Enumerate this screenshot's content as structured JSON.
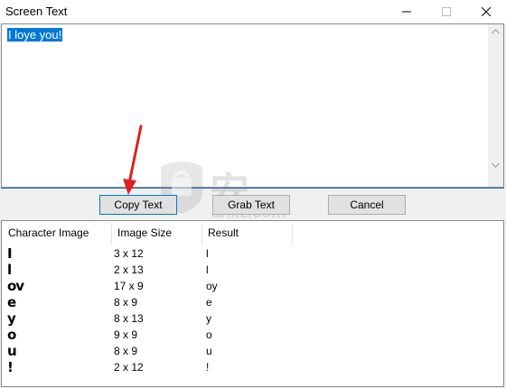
{
  "window": {
    "title": "Screen Text",
    "controls": [
      "minimize-icon",
      "maximize-icon",
      "close-icon"
    ]
  },
  "textarea": {
    "selected_text": "I loye you!"
  },
  "buttons": {
    "copy": "Copy Text",
    "grab": "Grab Text",
    "cancel": "Cancel"
  },
  "list": {
    "columns": [
      "Character Image",
      "Image Size",
      "Result"
    ],
    "rows": [
      {
        "image": "I",
        "size": "3 x 12",
        "result": "l"
      },
      {
        "image": "l",
        "size": "2 x 13",
        "result": "l"
      },
      {
        "image": "ov",
        "size": "17 x 9",
        "result": "oy"
      },
      {
        "image": "e",
        "size": "8 x 9",
        "result": "e"
      },
      {
        "image": "y",
        "size": "8 x 13",
        "result": "y"
      },
      {
        "image": "o",
        "size": "9 x 9",
        "result": "o"
      },
      {
        "image": "u",
        "size": "8 x 9",
        "result": "u"
      },
      {
        "image": "!",
        "size": "2 x 12",
        "result": "!"
      }
    ]
  },
  "watermark": {
    "text": "安下载",
    "sub": "anxz.com"
  },
  "colors": {
    "selection": "#0078d7",
    "annotation_arrow": "#e02020"
  }
}
